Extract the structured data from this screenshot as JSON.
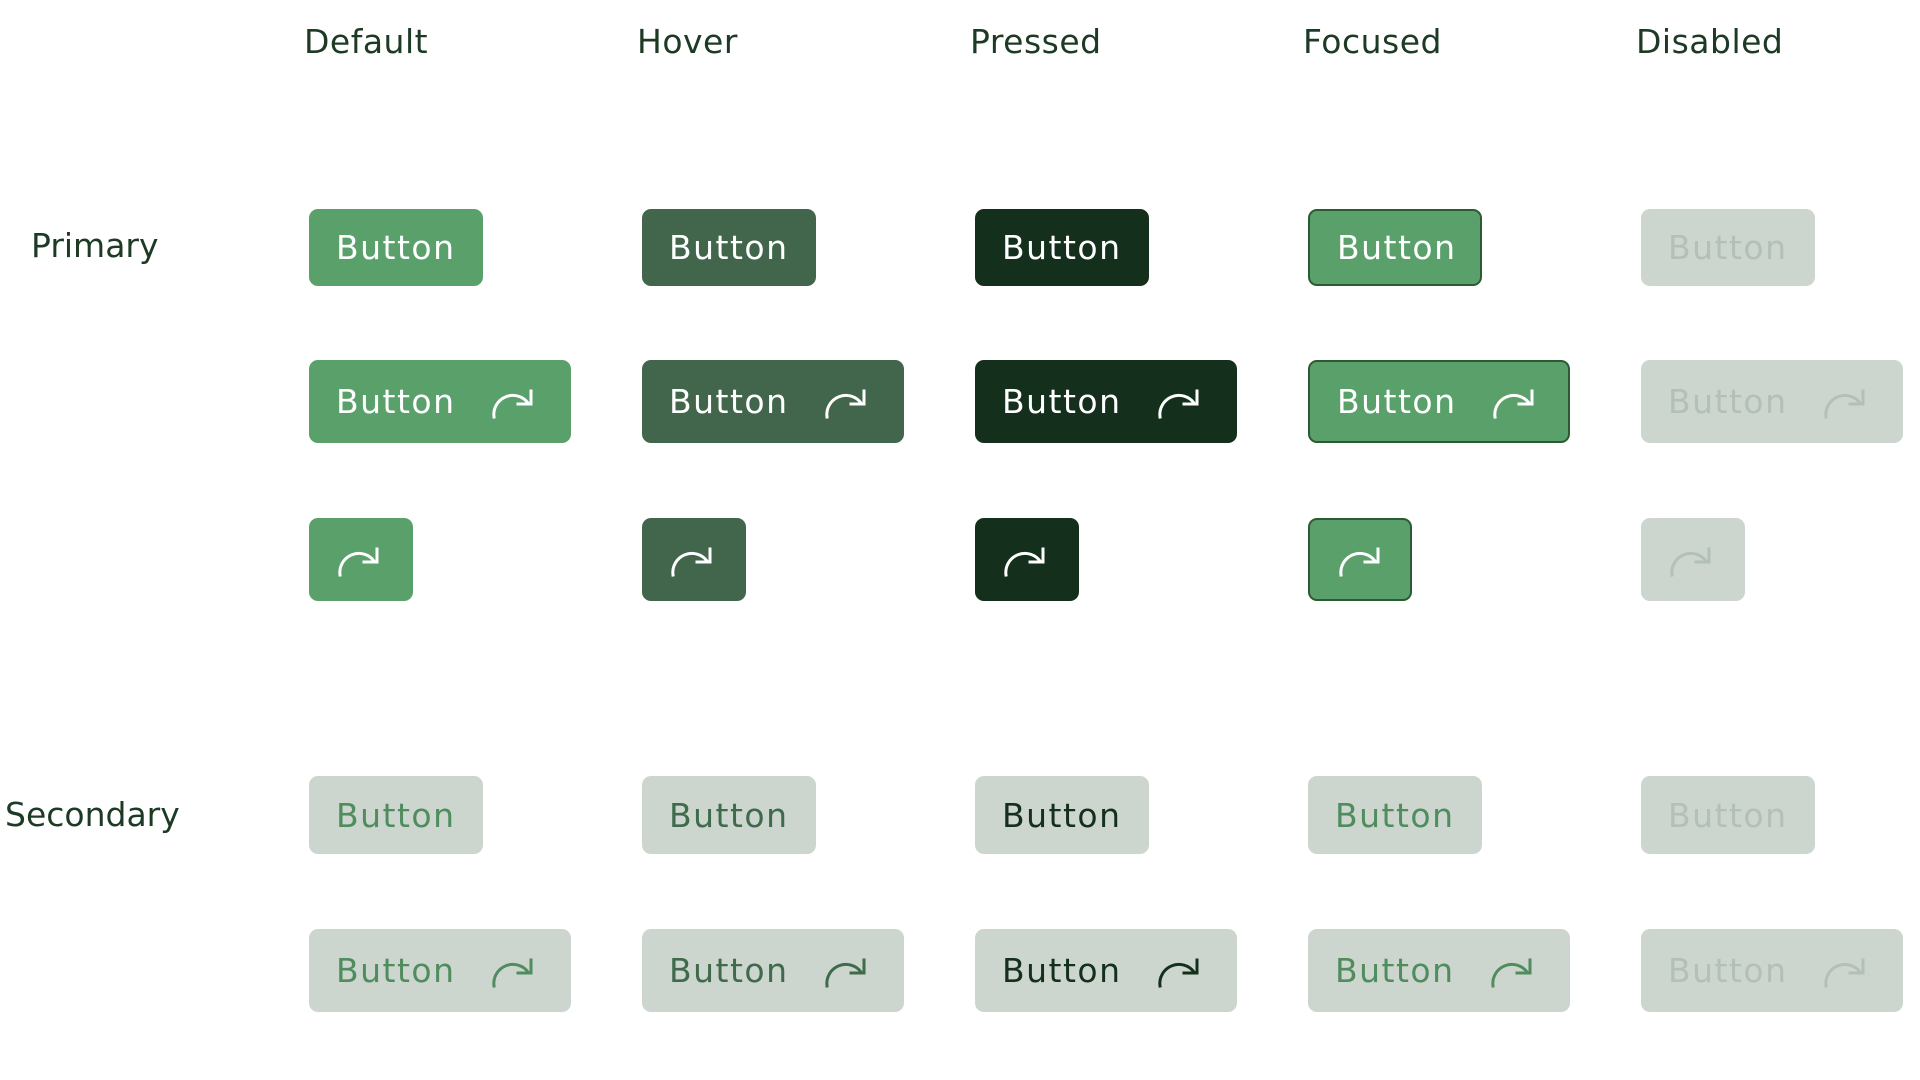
{
  "columns": [
    "Default",
    "Hover",
    "Pressed",
    "Focused",
    "Disabled"
  ],
  "rows": {
    "primary_label": "Primary",
    "secondary_label": "Secondary"
  },
  "button_label": "Button",
  "icon": "redo-arrow-icon",
  "colors": {
    "primary": {
      "Default": {
        "bg": "#5aa06b",
        "fg": "#ffffff",
        "border": "none"
      },
      "Hover": {
        "bg": "#42664b",
        "fg": "#ffffff",
        "border": "none"
      },
      "Pressed": {
        "bg": "#142f1c",
        "fg": "#ffffff",
        "border": "none"
      },
      "Focused": {
        "bg": "#5aa06b",
        "fg": "#ffffff",
        "border": "#2c5a33"
      },
      "Disabled": {
        "bg": "#cdd6ce",
        "fg": "#b3c0b5",
        "border": "none"
      }
    },
    "secondary": {
      "Default": {
        "bg": "#cdd6ce",
        "fg": "#4f8c5e",
        "border": "none"
      },
      "Hover": {
        "bg": "#cdd6ce",
        "fg": "#3f6a4b",
        "border": "none"
      },
      "Pressed": {
        "bg": "#cdd6ce",
        "fg": "#14301c",
        "border": "none"
      },
      "Focused": {
        "bg": "#cdd6ce",
        "fg": "#4f8c5e",
        "border": "none"
      },
      "Disabled": {
        "bg": "#cdd6ce",
        "fg": "#b3c0b5",
        "border": "none"
      }
    }
  }
}
